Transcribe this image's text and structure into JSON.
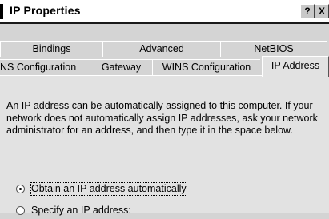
{
  "window": {
    "title": "IP Properties",
    "help_button": "?",
    "close_button": "X"
  },
  "tabs_row1": [
    {
      "label": "Bindings"
    },
    {
      "label": "Advanced"
    },
    {
      "label": "NetBIOS"
    }
  ],
  "tabs_row2": [
    {
      "label": "NS Configuration"
    },
    {
      "label": "Gateway"
    },
    {
      "label": "WINS Configuration"
    },
    {
      "label": "IP Address",
      "active": true
    }
  ],
  "ip_address": {
    "description": "An IP address can be automatically assigned to this computer. If your network does not automatically assign IP addresses, ask your network administrator for an address, and then type it in the space below.",
    "options": [
      {
        "label": "Obtain an IP address automatically",
        "selected": true
      },
      {
        "label": "Specify an IP address:",
        "selected": false
      }
    ]
  }
}
